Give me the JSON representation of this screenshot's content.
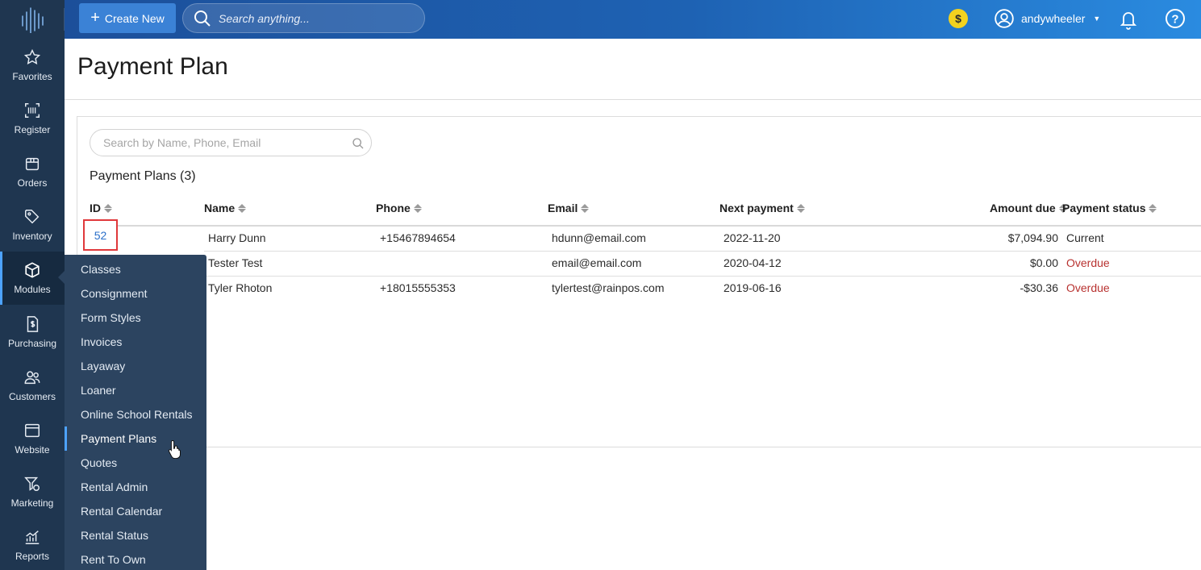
{
  "topbar": {
    "create_label": "Create New",
    "search_placeholder": "Search anything...",
    "coin_symbol": "$",
    "username": "andywheeler",
    "help_symbol": "?"
  },
  "sidebar": {
    "items": [
      {
        "label": "Favorites",
        "icon": "star-icon"
      },
      {
        "label": "Register",
        "icon": "barcode-icon"
      },
      {
        "label": "Orders",
        "icon": "package-icon"
      },
      {
        "label": "Inventory",
        "icon": "tag-icon"
      },
      {
        "label": "Modules",
        "icon": "cube-icon",
        "active": true
      },
      {
        "label": "Purchasing",
        "icon": "document-dollar-icon"
      },
      {
        "label": "Customers",
        "icon": "people-icon"
      },
      {
        "label": "Website",
        "icon": "browser-window-icon"
      },
      {
        "label": "Marketing",
        "icon": "funnel-dollar-icon"
      },
      {
        "label": "Reports",
        "icon": "chart-icon"
      }
    ]
  },
  "flyout": {
    "items": [
      "Classes",
      "Consignment",
      "Form Styles",
      "Invoices",
      "Layaway",
      "Loaner",
      "Online School Rentals",
      "Payment Plans",
      "Quotes",
      "Rental Admin",
      "Rental Calendar",
      "Rental Status",
      "Rent To Own"
    ],
    "selected": "Payment Plans"
  },
  "page": {
    "title": "Payment Plan",
    "search_placeholder": "Search by Name, Phone, Email",
    "plans_count_label": "Payment Plans (3)"
  },
  "table": {
    "columns": [
      "ID",
      "Name",
      "Phone",
      "Email",
      "Next payment",
      "Amount due",
      "Payment status"
    ],
    "rows": [
      {
        "id": "52",
        "name": "Harry Dunn",
        "phone": "+15467894654",
        "email": "hdunn@email.com",
        "next_payment": "2022-11-20",
        "amount_due": "$7,094.90",
        "status": "Current"
      },
      {
        "id": "",
        "name": "Tester Test",
        "phone": "",
        "email": "email@email.com",
        "next_payment": "2020-04-12",
        "amount_due": "$0.00",
        "status": "Overdue"
      },
      {
        "id": "",
        "name": "Tyler Rhoton",
        "phone": "+18015555353",
        "email": "tylertest@rainpos.com",
        "next_payment": "2019-06-16",
        "amount_due": "-$30.36",
        "status": "Overdue"
      }
    ]
  },
  "colors": {
    "sidebar_bg": "#1f3650",
    "flyout_bg": "#2c4460",
    "topbar_start": "#1c4f9a",
    "topbar_end": "#2a8be0",
    "accent": "#4da3ff",
    "link": "#2a6fc9",
    "overdue": "#b83230",
    "highlight_box": "#e0383b"
  }
}
